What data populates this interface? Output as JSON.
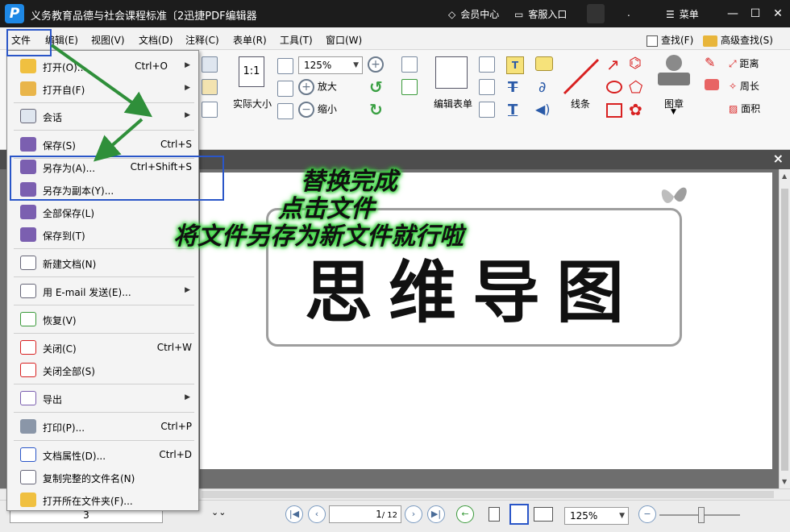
{
  "title_bar": {
    "logo": "P",
    "title": "义务教育品德与社会课程标准〔2迅捷PDF编辑器",
    "vip_label": "会员中心",
    "service_label": "客服入口",
    "dot": ".",
    "menu_label": "菜单"
  },
  "menu_bar": {
    "items": [
      "文件",
      "编辑(E)",
      "视图(V)",
      "文档(D)",
      "注释(C)",
      "表单(R)",
      "工具(T)",
      "窗口(W)"
    ],
    "search": "查找(F)",
    "advanced_search": "高级查找(S)"
  },
  "toolbar": {
    "actual_size": "实际大小",
    "actual_size_icon": "1:1",
    "zoom_value": "125%",
    "zoom_in": "放大",
    "zoom_out": "缩小",
    "edit_form": "编辑表单",
    "line": "线条",
    "stamp": "图章",
    "distance": "距离",
    "perimeter": "周长",
    "area": "面积"
  },
  "file_menu": {
    "items": [
      {
        "label": "打开(O)...",
        "shortcut": "Ctrl+O"
      },
      {
        "label": "打开自(F)",
        "shortcut": ""
      },
      {
        "label": "会话",
        "shortcut": ""
      },
      {
        "label": "保存(S)",
        "shortcut": "Ctrl+S"
      },
      {
        "label": "另存为(A)...",
        "shortcut": "Ctrl+Shift+S"
      },
      {
        "label": "另存为副本(Y)...",
        "shortcut": ""
      },
      {
        "label": "全部保存(L)",
        "shortcut": ""
      },
      {
        "label": "保存到(T)",
        "shortcut": ""
      },
      {
        "label": "新建文档(N)",
        "shortcut": ""
      },
      {
        "label": "用 E-mail 发送(E)...",
        "shortcut": ""
      },
      {
        "label": "恢复(V)",
        "shortcut": ""
      },
      {
        "label": "关闭(C)",
        "shortcut": "Ctrl+W"
      },
      {
        "label": "关闭全部(S)",
        "shortcut": ""
      },
      {
        "label": "导出",
        "shortcut": ""
      },
      {
        "label": "打印(P)...",
        "shortcut": "Ctrl+P"
      },
      {
        "label": "文档属性(D)...",
        "shortcut": "Ctrl+D"
      },
      {
        "label": "复制完整的文件名(N)",
        "shortcut": ""
      },
      {
        "label": "打开所在文件夹(F)...",
        "shortcut": ""
      }
    ]
  },
  "annotation": {
    "line1": "替换完成",
    "line2": "点击文件",
    "line3": "将文件另存为新文件就行啦"
  },
  "document": {
    "big_text": "思维导图"
  },
  "status_bar": {
    "left_value": "3",
    "page_current": "1",
    "page_total": "/ 12",
    "zoom_value": "125%"
  },
  "colors": {
    "title_bg": "#1c1c1c",
    "highlight": "#2a56c8",
    "arrow": "#2f8f3a",
    "glow": "#39d33f"
  }
}
